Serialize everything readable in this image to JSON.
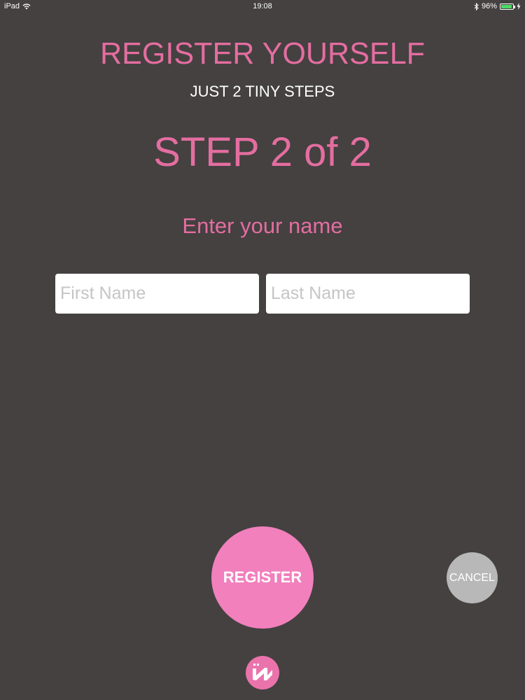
{
  "status_bar": {
    "device": "iPad",
    "time": "19:08",
    "battery": "96%",
    "battery_level": 0.96,
    "battery_color": "#4cd964"
  },
  "header": {
    "title": "REGISTER YOURSELF",
    "subtitle": "JUST 2 TINY STEPS"
  },
  "step": {
    "label": "STEP 2 of 2"
  },
  "form": {
    "prompt": "Enter your name",
    "first_name": {
      "value": "",
      "placeholder": "First Name"
    },
    "last_name": {
      "value": "",
      "placeholder": "Last Name"
    }
  },
  "actions": {
    "register_label": "REGISTER",
    "cancel_label": "CANCEL"
  },
  "colors": {
    "accent": "#e46da0",
    "button": "#f180bd",
    "background": "#444140",
    "cancel": "#b8b8b8"
  },
  "icons": {
    "logo": "app-logo-icon"
  }
}
